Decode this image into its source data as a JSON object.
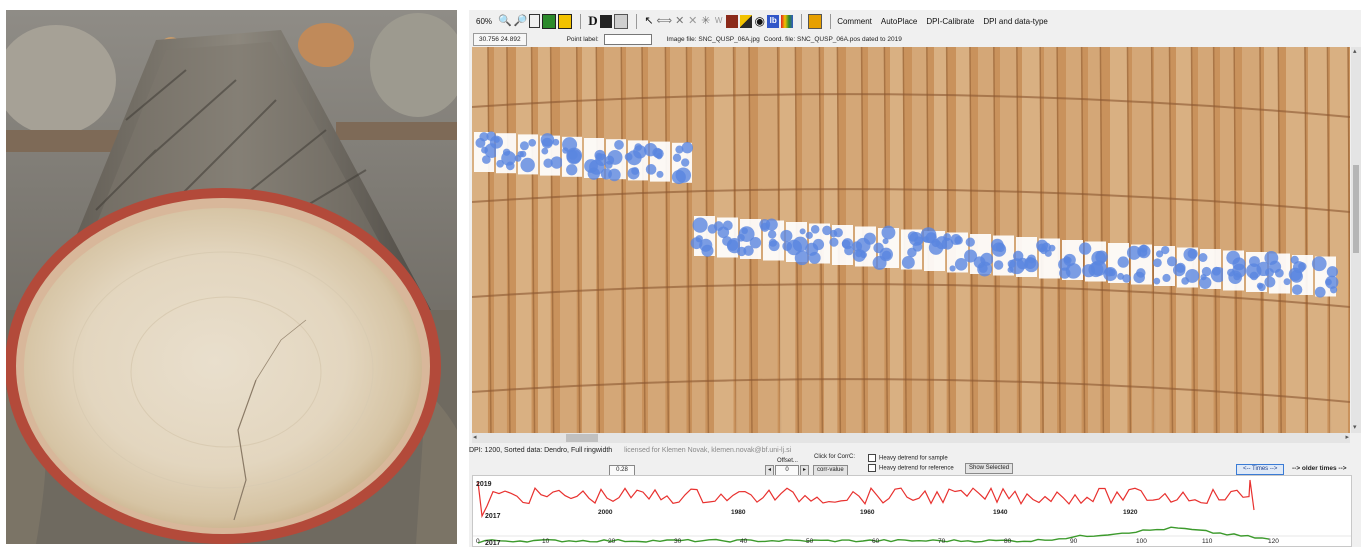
{
  "toolbar": {
    "zoom": "60%",
    "d_button": "D",
    "lb_button": "lb",
    "w_button": "W",
    "menu_comment": "Comment",
    "menu_autoplace": "AutoPlace",
    "menu_dpi_calibrate": "DPI-Calibrate",
    "menu_dpi_datatype": "DPI and data-type"
  },
  "status_bar": {
    "coordinates": "30.756  24.892",
    "point_label": "Point label:",
    "point_label_value": "",
    "image_file": "Image file: SNC_QUSP_06A.jpg",
    "coord_file": "Coord. file: SNC_QUSP_06A.pos dated to 2019"
  },
  "info": {
    "dpi_line": "DPI: 1200,  Sorted data: Dendro, Full ringwidth",
    "license": "licensed for Klemen Novak, klemen.novak@bf.uni-lj.si"
  },
  "controls": {
    "value_box": "0.28",
    "offset_label": "Offset...",
    "offset_value": "0",
    "corr_label": "Click for CorrC:",
    "corr_button": "corr-value",
    "heavy_sample": "Heavy detrend for sample",
    "heavy_reference": "Heavy detrend for reference",
    "show_selected": "Show Selected",
    "times_button": "<-- Times -->",
    "older_times": "--> older times -->"
  },
  "colors": {
    "red_series": "#e8312f",
    "green_series": "#3c9a2c",
    "accent_blue": "#3a7bd5",
    "label_purple": "#5a3aa8"
  },
  "chart": {
    "label_2019": "2019",
    "label_2017_red": "2017",
    "label_2017_green": "2017",
    "red_ticks": [
      "2000",
      "1980",
      "1960",
      "1940",
      "1920"
    ],
    "green_ticks": [
      "0",
      "10",
      "20",
      "30",
      "40",
      "50",
      "60",
      "70",
      "80",
      "90",
      "100",
      "110",
      "120"
    ]
  }
}
